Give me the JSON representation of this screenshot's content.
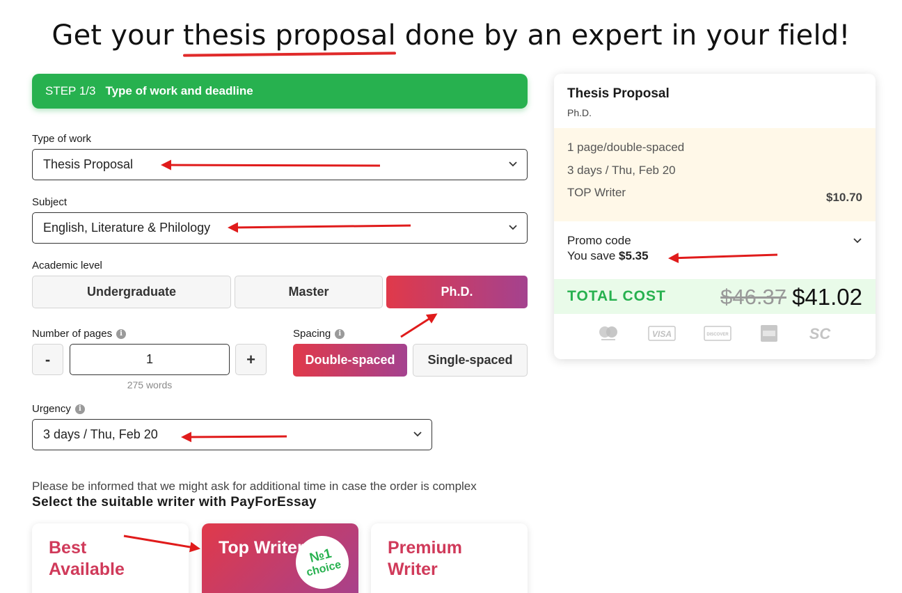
{
  "header": {
    "title_pre": "Get your ",
    "title_highlight": "thesis proposal",
    "title_post": " done by an expert in your field!"
  },
  "step": {
    "number": "STEP 1/3",
    "title": "Type of work and deadline"
  },
  "form": {
    "type_of_work": {
      "label": "Type of work",
      "value": "Thesis Proposal"
    },
    "subject": {
      "label": "Subject",
      "value": "English, Literature & Philology"
    },
    "academic_level": {
      "label": "Academic level",
      "options": [
        "Undergraduate",
        "Master",
        "Ph.D."
      ],
      "selected": "Ph.D."
    },
    "pages": {
      "label": "Number of pages",
      "minus": "-",
      "plus": "+",
      "value": "1",
      "words": "275 words"
    },
    "spacing": {
      "label": "Spacing",
      "options": [
        "Double-spaced",
        "Single-spaced"
      ],
      "selected": "Double-spaced"
    },
    "urgency": {
      "label": "Urgency",
      "value": "3 days / Thu, Feb 20"
    },
    "info_glyph": "i"
  },
  "notice": "Please be informed that we might ask for additional time in case the order is complex",
  "writers": {
    "heading": "Select the suitable writer with PayForEssay",
    "cards": [
      "Best Available",
      "Top Writer",
      "Premium Writer"
    ],
    "badge_num": "№1",
    "badge_text": "choice"
  },
  "summary": {
    "title": "Thesis Proposal",
    "level": "Ph.D.",
    "details": [
      "1 page/double-spaced",
      "3 days / Thu, Feb 20",
      "TOP Writer"
    ],
    "price": "$10.70",
    "promo_label": "Promo code",
    "promo_save_prefix": "You save ",
    "promo_save_amount": "$5.35",
    "total_label": "TOTAL COST",
    "total_old": "$46.37",
    "total_new": "$41.02",
    "payment_icons": [
      "mastercard-icon",
      "visa-icon",
      "discover-icon",
      "amex-icon",
      "sc-icon"
    ],
    "payment_labels": [
      "VISA",
      "DISCOVER",
      "SC"
    ]
  },
  "colors": {
    "green": "#27b14f",
    "gradient_start": "#e0394a",
    "gradient_end": "#a4428f",
    "annotation_arrow": "#e01b1b"
  }
}
